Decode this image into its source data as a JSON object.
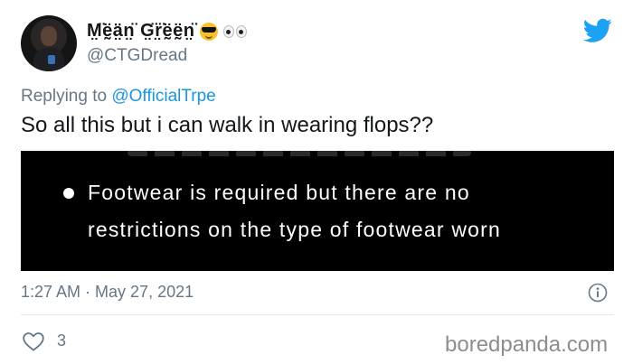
{
  "author": {
    "display_name": "M̤̈ḛ̈ä̤n̤̈ G̤̈r̤̈ḛ̈ḛ̈n̤̈",
    "emoji_1": "sunglasses-face-emoji",
    "emoji_2": "eyes-emoji",
    "handle": "@CTGDread"
  },
  "reply": {
    "prefix": "Replying to",
    "target": "@OfficialTrpe"
  },
  "tweet": {
    "text": "So all this but i can walk in wearing flops??"
  },
  "media": {
    "line1": "Footwear is required but there are no",
    "line2": "restrictions on the type of footwear worn"
  },
  "meta": {
    "timestamp": "1:27 AM · May 27, 2021",
    "like_count": "3"
  },
  "watermark": "boredpanda.com",
  "colors": {
    "twitter_blue": "#1da1f2",
    "link_blue": "#1b95e0",
    "muted_gray": "#657786"
  },
  "icons": {
    "brand": "twitter-bird-icon",
    "info": "info-icon",
    "like": "heart-icon"
  }
}
